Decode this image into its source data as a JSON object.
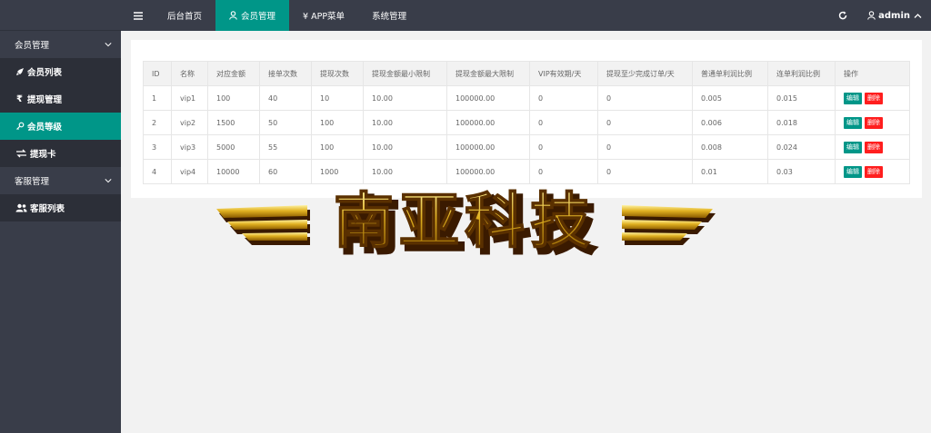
{
  "topbar": {
    "menu": [
      {
        "label": "后台首页",
        "active": false
      },
      {
        "label": "会员管理",
        "active": true
      },
      {
        "label": "¥ APP菜单",
        "active": false
      },
      {
        "label": "系统管理",
        "active": false
      }
    ],
    "user": "admin"
  },
  "sidebar": {
    "groups": [
      {
        "label": "会员管理",
        "items": [
          "会员列表",
          "提现管理",
          "会员等级",
          "提现卡"
        ]
      },
      {
        "label": "客服管理",
        "items": [
          "客服列表"
        ]
      }
    ],
    "active_item": "会员等级"
  },
  "table": {
    "headers": [
      "ID",
      "名称",
      "对应金额",
      "接单次数",
      "提现次数",
      "提现金额最小限制",
      "提现金额最大限制",
      "VIP有效期/天",
      "提现至少完成订单/天",
      "普通单利润比例",
      "连单利润比例",
      "操作"
    ],
    "rows": [
      [
        "1",
        "vip1",
        "100",
        "40",
        "10",
        "10.00",
        "100000.00",
        "0",
        "0",
        "0.005",
        "0.015"
      ],
      [
        "2",
        "vip2",
        "1500",
        "50",
        "100",
        "10.00",
        "100000.00",
        "0",
        "0",
        "0.006",
        "0.018"
      ],
      [
        "3",
        "vip3",
        "5000",
        "55",
        "100",
        "10.00",
        "100000.00",
        "0",
        "0",
        "0.008",
        "0.024"
      ],
      [
        "4",
        "vip4",
        "10000",
        "60",
        "1000",
        "10.00",
        "100000.00",
        "0",
        "0",
        "0.01",
        "0.03"
      ]
    ],
    "edit_label": "编辑",
    "delete_label": "删除"
  },
  "watermark": {
    "text": "南亚科技"
  },
  "colors": {
    "sidebar": "#393d49",
    "accent": "#009688",
    "danger": "#ff1e1e"
  }
}
